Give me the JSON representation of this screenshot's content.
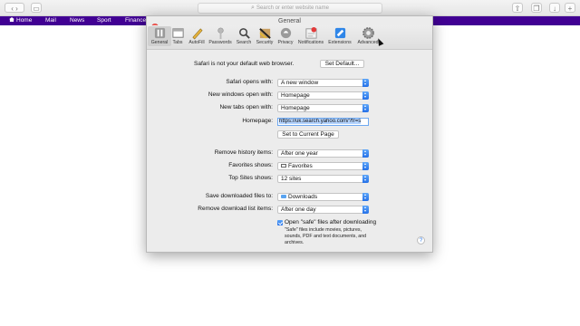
{
  "browser": {
    "address_placeholder": "Search or enter website name",
    "favorites": [
      "Home",
      "Mail",
      "News",
      "Sport",
      "Finance"
    ]
  },
  "prefs": {
    "title": "General",
    "tabs": [
      {
        "label": "General",
        "icon": "general-switch-icon"
      },
      {
        "label": "Tabs",
        "icon": "tabs-icon"
      },
      {
        "label": "AutoFill",
        "icon": "autofill-pencil-icon"
      },
      {
        "label": "Passwords",
        "icon": "key-icon"
      },
      {
        "label": "Search",
        "icon": "search-icon"
      },
      {
        "label": "Security",
        "icon": "security-icon"
      },
      {
        "label": "Privacy",
        "icon": "privacy-icon"
      },
      {
        "label": "Notifications",
        "icon": "notifications-icon"
      },
      {
        "label": "Extensions",
        "icon": "extensions-icon"
      },
      {
        "label": "Advanced",
        "icon": "gear-icon"
      }
    ],
    "default_browser_text": "Safari is not your default web browser.",
    "set_default_label": "Set Default...",
    "rows": {
      "opens_with": {
        "label": "Safari opens with:",
        "value": "A new window"
      },
      "new_windows": {
        "label": "New windows open with:",
        "value": "Homepage"
      },
      "new_tabs": {
        "label": "New tabs open with:",
        "value": "Homepage"
      },
      "homepage": {
        "label": "Homepage:",
        "value": "https://uk.search.yahoo.com/?fr=s"
      },
      "set_current_label": "Set to Current Page",
      "remove_history": {
        "label": "Remove history items:",
        "value": "After one year"
      },
      "favorites_shows": {
        "label": "Favorites shows:",
        "value": "Favorites"
      },
      "top_sites": {
        "label": "Top Sites shows:",
        "value": "12 sites"
      },
      "save_downloads": {
        "label": "Save downloaded files to:",
        "value": "Downloads"
      },
      "remove_downloads": {
        "label": "Remove download list items:",
        "value": "After one day"
      }
    },
    "open_safe_label": "Open \"safe\" files after downloading",
    "safe_note": "\"Safe\" files include movies, pictures, sounds, PDF and text documents, and archives.",
    "help_label": "?"
  },
  "colors": {
    "favbar": "#410093",
    "accent": "#2470e8"
  }
}
